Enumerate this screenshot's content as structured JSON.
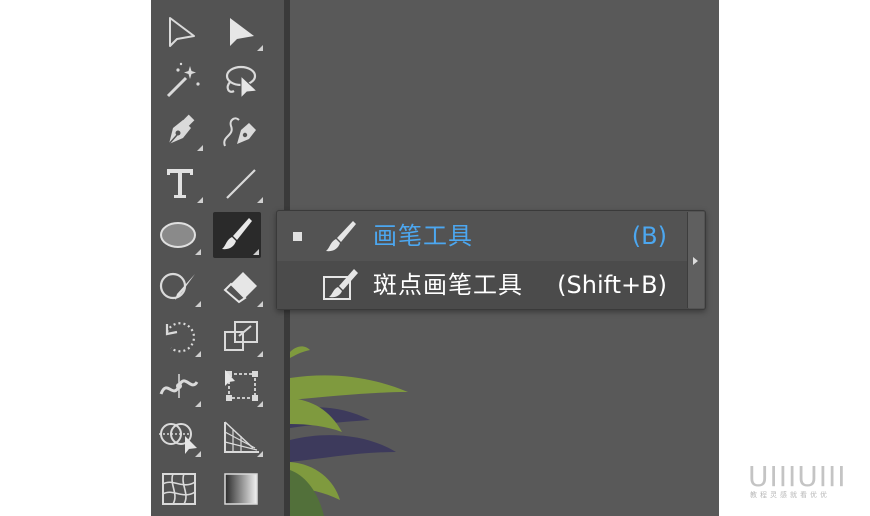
{
  "toolbar": {
    "tools": [
      {
        "name": "selection-tool"
      },
      {
        "name": "direct-selection-tool"
      },
      {
        "name": "magic-wand-tool"
      },
      {
        "name": "lasso-tool"
      },
      {
        "name": "pen-tool"
      },
      {
        "name": "curvature-tool"
      },
      {
        "name": "type-tool"
      },
      {
        "name": "line-segment-tool"
      },
      {
        "name": "ellipse-tool"
      },
      {
        "name": "paintbrush-tool",
        "active": true
      },
      {
        "name": "shaper-tool"
      },
      {
        "name": "eraser-tool"
      },
      {
        "name": "rotate-tool"
      },
      {
        "name": "scale-tool"
      },
      {
        "name": "width-tool"
      },
      {
        "name": "free-transform-tool"
      },
      {
        "name": "shape-builder-tool"
      },
      {
        "name": "perspective-grid-tool"
      },
      {
        "name": "mesh-tool"
      },
      {
        "name": "gradient-tool"
      }
    ]
  },
  "flyout": {
    "items": [
      {
        "label": "画笔工具",
        "shortcut": "(B)",
        "selected": true,
        "icon": "paintbrush-icon",
        "color": "#4ca7f0"
      },
      {
        "label": "斑点画笔工具",
        "shortcut": "(Shift+B)",
        "selected": false,
        "icon": "blob-brush-icon",
        "color": "#ffffff"
      }
    ]
  },
  "watermark": {
    "logo": "UIIIUIII",
    "subtitle": "教程灵感就看优优"
  },
  "colors": {
    "toolbar_bg": "#535353",
    "canvas_bg": "#595959",
    "accent": "#4ca7f0",
    "leaf_green": "#7f9a3e",
    "leaf_purple": "#3d3a5c"
  }
}
